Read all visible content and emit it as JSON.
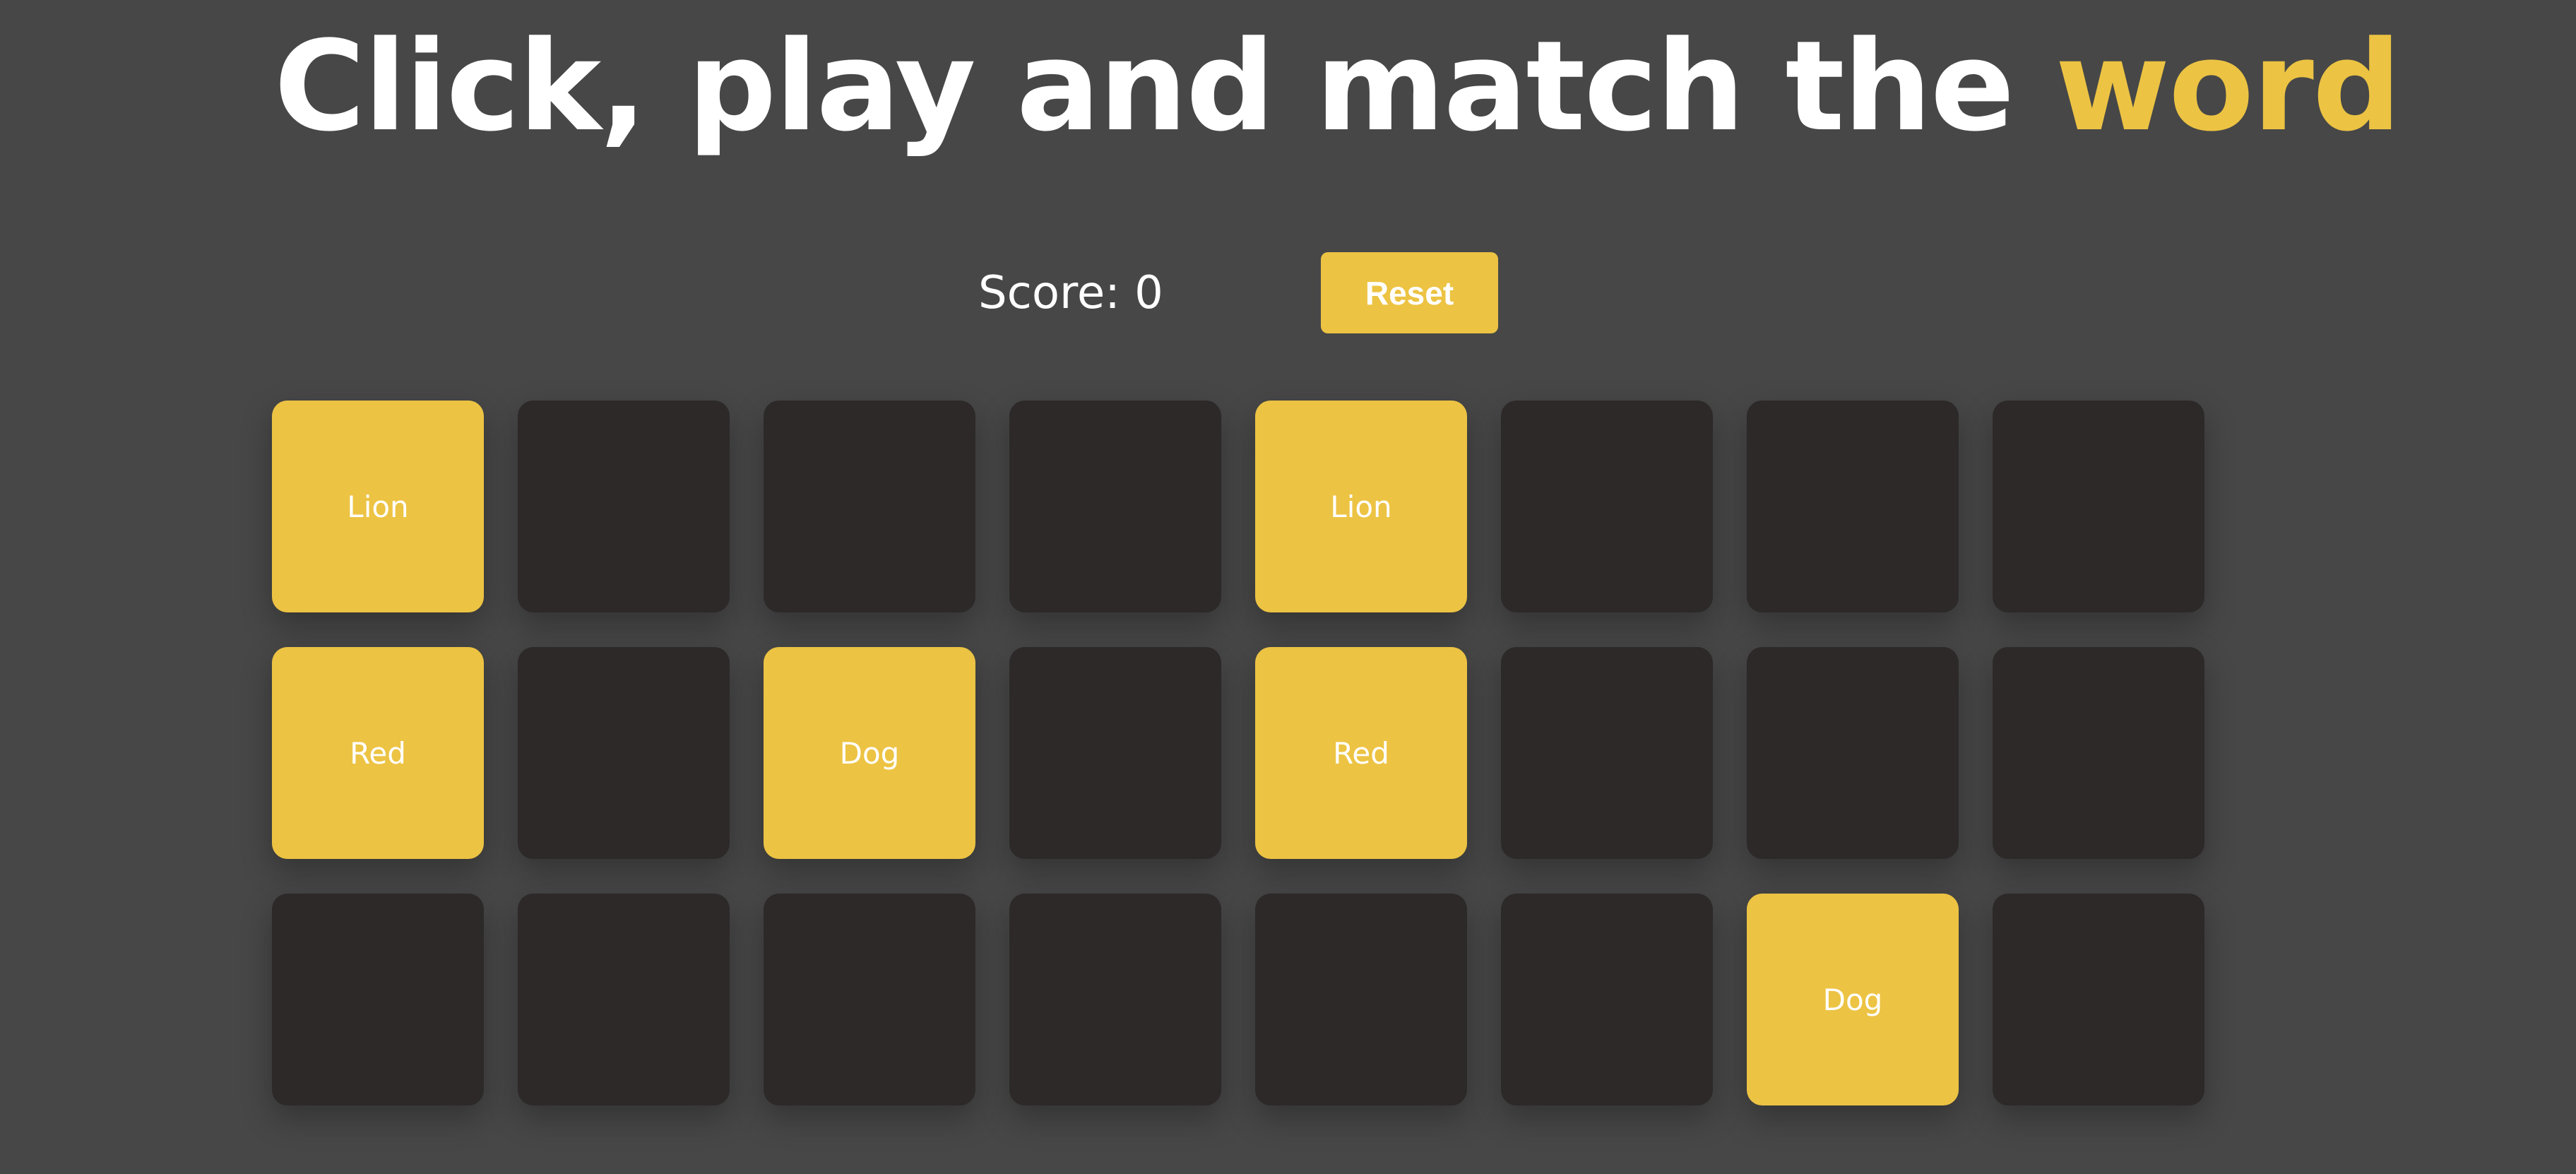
{
  "header": {
    "title_main": "Click, play and match the ",
    "title_accent": "word"
  },
  "scoreboard": {
    "score_text": "Score: 0",
    "reset_label": "Reset"
  },
  "colors": {
    "background": "#474747",
    "accent": "#ecc343",
    "card_hidden": "#2d2929",
    "text": "#ffffff"
  },
  "board": {
    "columns": 8,
    "rows": 3,
    "cards": [
      {
        "label": "Lion",
        "revealed": true
      },
      {
        "label": "",
        "revealed": false
      },
      {
        "label": "",
        "revealed": false
      },
      {
        "label": "",
        "revealed": false
      },
      {
        "label": "Lion",
        "revealed": true
      },
      {
        "label": "",
        "revealed": false
      },
      {
        "label": "",
        "revealed": false
      },
      {
        "label": "",
        "revealed": false
      },
      {
        "label": "Red",
        "revealed": true
      },
      {
        "label": "",
        "revealed": false
      },
      {
        "label": "Dog",
        "revealed": true
      },
      {
        "label": "",
        "revealed": false
      },
      {
        "label": "Red",
        "revealed": true
      },
      {
        "label": "",
        "revealed": false
      },
      {
        "label": "",
        "revealed": false
      },
      {
        "label": "",
        "revealed": false
      },
      {
        "label": "",
        "revealed": false
      },
      {
        "label": "",
        "revealed": false
      },
      {
        "label": "",
        "revealed": false
      },
      {
        "label": "",
        "revealed": false
      },
      {
        "label": "",
        "revealed": false
      },
      {
        "label": "",
        "revealed": false
      },
      {
        "label": "Dog",
        "revealed": true
      },
      {
        "label": "",
        "revealed": false
      }
    ]
  }
}
